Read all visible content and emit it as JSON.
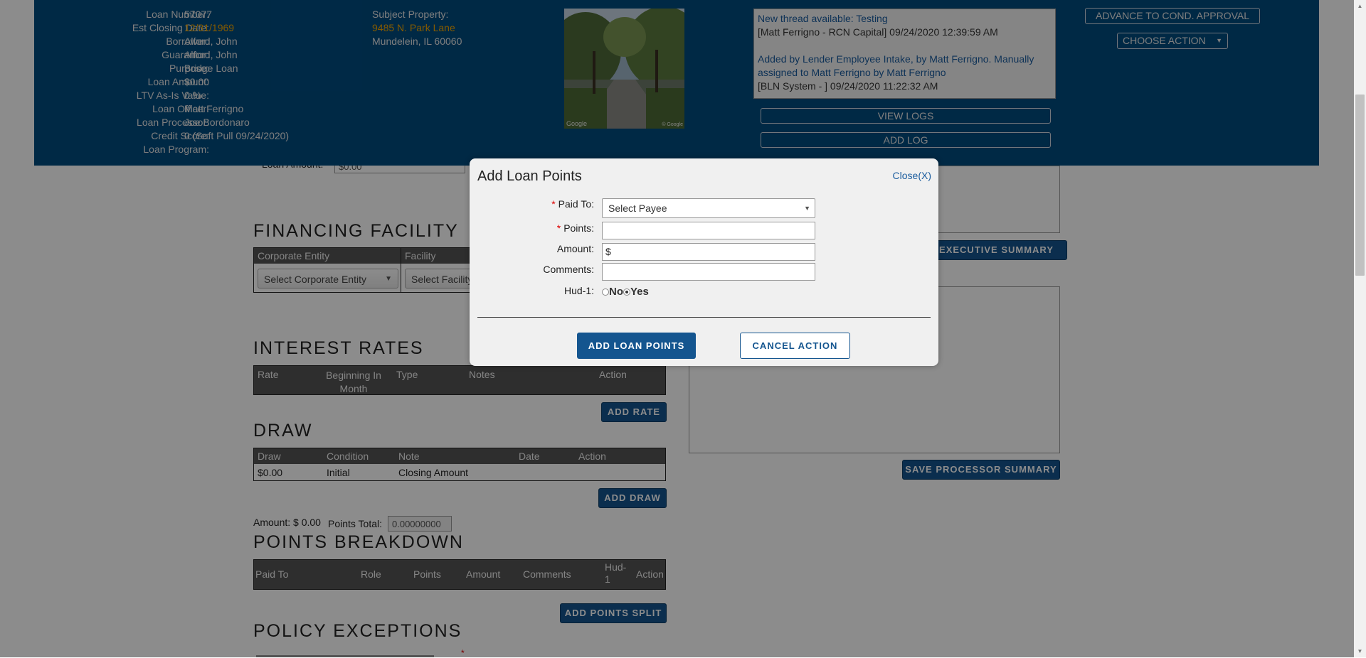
{
  "header": {
    "info": [
      {
        "label": "Loan Number:",
        "value": "57077"
      },
      {
        "label": "Est Closing Date:",
        "value": "12/31/1969"
      },
      {
        "label": "Borrower:",
        "value": "Alford, John"
      },
      {
        "label": "Guarantor:",
        "value": "Alford, John"
      },
      {
        "label": "Purpose:",
        "value": "Bridge Loan"
      },
      {
        "label": "Loan Amount:",
        "value": "$0.00"
      },
      {
        "label": "LTV As-Is Value:",
        "value": "0 %"
      },
      {
        "label": "Loan Officer:",
        "value": "Matt Ferrigno"
      },
      {
        "label": "Loan Processor:",
        "value": "Joe Bordonaro"
      },
      {
        "label": "Credit Score:",
        "value": "0 (Soft Pull 09/24/2020)"
      },
      {
        "label": "Loan Program:",
        "value": ""
      }
    ],
    "subject_label": "Subject Property:",
    "subject_address": "9485 N. Park Lane",
    "subject_city": "Mundelein, IL 60060",
    "photo_caption_left": "Google",
    "photo_caption_right": "© Google",
    "log": {
      "thread_link": "New thread available: Testing",
      "entry1": "[Matt Ferrigno - RCN Capital] 09/24/2020 12:39:59 AM",
      "entry2_link": "Added by Lender Employee Intake, by Matt Ferrigno. Manually assigned to Matt Ferrigno by Matt Ferrigno",
      "entry2": "[BLN System - ] 09/24/2020 11:22:32 AM"
    },
    "view_logs": "VIEW LOGS",
    "add_log": "ADD LOG",
    "advance_button": "ADVANCE TO COND. APPROVAL",
    "choose_action": "CHOOSE ACTION"
  },
  "body": {
    "loan_amount_label": "Loan Amount:",
    "loan_amount_value": "$0.00",
    "financing": {
      "title": "FINANCING FACILITY",
      "col1": "Corporate Entity",
      "col2": "Facility",
      "select_entity": "Select Corporate Entity",
      "select_facility": "Select Facility"
    },
    "exec_summary_button": "SAVE EXECUTIVE SUMMARY",
    "processor_summary_button": "SAVE PROCESSOR SUMMARY",
    "interest": {
      "title": "INTEREST RATES",
      "cols": [
        "Rate",
        "Beginning In Month",
        "Type",
        "Notes",
        "Action"
      ],
      "add_button": "ADD RATE"
    },
    "draw": {
      "title": "DRAW",
      "cols": [
        "Draw",
        "Condition",
        "Note",
        "Date",
        "Action"
      ],
      "row": [
        "$0.00",
        "Initial",
        "Closing Amount",
        "",
        ""
      ],
      "add_button": "ADD DRAW"
    },
    "amount_text": "Amount: $ 0.00",
    "points_total_label": "Points Total:",
    "points_total_value": "0.00000000",
    "points": {
      "title": "POINTS BREAKDOWN",
      "cols": [
        "Paid To",
        "Role",
        "Points",
        "Amount",
        "Comments",
        "Hud-1",
        "Action"
      ],
      "add_button": "ADD POINTS SPLIT"
    },
    "policy_title": "POLICY EXCEPTIONS"
  },
  "modal": {
    "title": "Add Loan Points",
    "close": "Close(X)",
    "paid_to_label": "Paid To:",
    "paid_to_value": "Select Payee",
    "points_label": "Points:",
    "points_value": "",
    "amount_label": "Amount:",
    "amount_value": "$",
    "comments_label": "Comments:",
    "comments_value": "",
    "hud_label": "Hud-1:",
    "hud_no": "No",
    "hud_yes": "Yes",
    "hud_selected": "Yes",
    "add_button": "ADD LOAN POINTS",
    "cancel_button": "CANCEL ACTION"
  }
}
